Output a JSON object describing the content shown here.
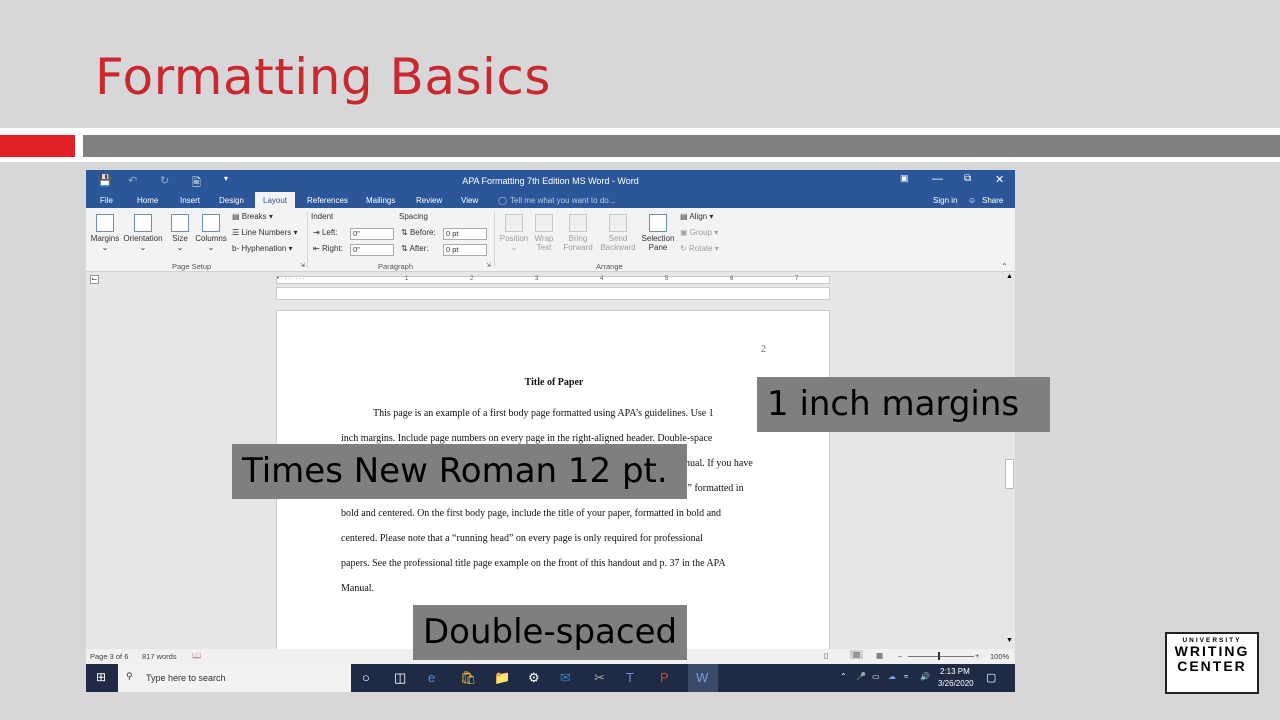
{
  "slide": {
    "title": "Formatting Basics",
    "colors": {
      "title": "#c8282e",
      "accent_red": "#e01f26",
      "accent_gray": "#808080"
    }
  },
  "word": {
    "window_title": "APA Formatting 7th Edition MS Word - Word",
    "quick_access": [
      "save-icon",
      "undo-icon",
      "redo-icon",
      "new-document-icon",
      "customize-icon"
    ],
    "window_controls": [
      "ribbon-display-options-icon",
      "minimize-icon",
      "restore-icon",
      "close-icon"
    ],
    "tabs": [
      "File",
      "Home",
      "Insert",
      "Design",
      "Layout",
      "References",
      "Mailings",
      "Review",
      "View"
    ],
    "active_tab": "Layout",
    "tell_me_placeholder": "Tell me what you want to do...",
    "sign_in": "Sign in",
    "share": "Share",
    "ribbon": {
      "page_setup": {
        "group_label": "Page Setup",
        "buttons": [
          "Margins",
          "Orientation",
          "Size",
          "Columns"
        ],
        "small_buttons": [
          "Breaks",
          "Line Numbers",
          "Hyphenation"
        ]
      },
      "paragraph": {
        "group_label": "Paragraph",
        "indent_label": "Indent",
        "left_label": "Left:",
        "left_value": "0\"",
        "right_label": "Right:",
        "right_value": "0\"",
        "spacing_label": "Spacing",
        "before_label": "Before:",
        "before_value": "0 pt",
        "after_label": "After:",
        "after_value": "0 pt"
      },
      "arrange": {
        "group_label": "Arrange",
        "buttons": [
          {
            "label": "Position",
            "sub": ""
          },
          {
            "label": "Wrap",
            "sub": "Text"
          },
          {
            "label": "Bring",
            "sub": "Forward"
          },
          {
            "label": "Send",
            "sub": "Backward"
          },
          {
            "label": "Selection",
            "sub": "Pane"
          }
        ],
        "small_buttons": [
          "Align",
          "Group",
          "Rotate"
        ]
      }
    },
    "ruler_marks": [
      "1",
      "2",
      "3",
      "4",
      "5",
      "6",
      "7"
    ],
    "document": {
      "page_number": "2",
      "title": "Title of Paper",
      "lines": [
        "This page is an example of a first body page formatted using APA’s guidelines. Use 1",
        "inch margins. Include page numbers on every page in the right-aligned header. Double-space",
        "nual. If you have",
        ",” formatted in",
        "bold and centered. On the first body page, include the title of your paper, formatted in bold and",
        "centered. Please note that a “running head” on every page is only required for professional",
        "papers. See the professional title page example on the front of this handout and p. 37 in the APA",
        "Manual."
      ]
    },
    "status_bar": {
      "page": "Page 3 of 6",
      "words": "817 words",
      "zoom": "100%"
    },
    "taskbar": {
      "search_placeholder": "Type here to search",
      "time": "2:13 PM",
      "date": "3/26/2020"
    }
  },
  "callouts": {
    "margins": "1 inch margins",
    "font": "Times New Roman 12 pt.",
    "spacing": "Double-spaced"
  },
  "logo": {
    "line1": "UNIVERSITY",
    "line2": "WRITING",
    "line3": "CENTER"
  }
}
